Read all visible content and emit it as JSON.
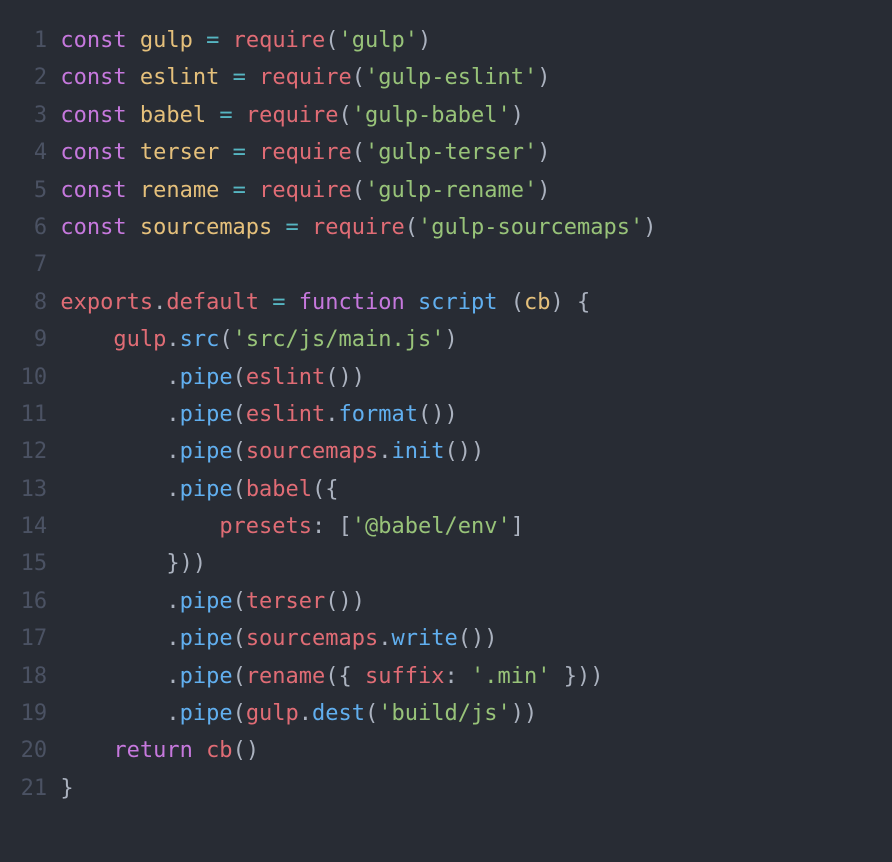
{
  "code": {
    "lines": [
      {
        "num": "1",
        "tokens": [
          {
            "t": "const ",
            "c": "kw"
          },
          {
            "t": "gulp",
            "c": "var"
          },
          {
            "t": " ",
            "c": "default"
          },
          {
            "t": "=",
            "c": "op"
          },
          {
            "t": " ",
            "c": "default"
          },
          {
            "t": "require",
            "c": "call"
          },
          {
            "t": "(",
            "c": "punc"
          },
          {
            "t": "'gulp'",
            "c": "str"
          },
          {
            "t": ")",
            "c": "punc"
          }
        ]
      },
      {
        "num": "2",
        "tokens": [
          {
            "t": "const ",
            "c": "kw"
          },
          {
            "t": "eslint",
            "c": "var"
          },
          {
            "t": " ",
            "c": "default"
          },
          {
            "t": "=",
            "c": "op"
          },
          {
            "t": " ",
            "c": "default"
          },
          {
            "t": "require",
            "c": "call"
          },
          {
            "t": "(",
            "c": "punc"
          },
          {
            "t": "'gulp-eslint'",
            "c": "str"
          },
          {
            "t": ")",
            "c": "punc"
          }
        ]
      },
      {
        "num": "3",
        "tokens": [
          {
            "t": "const ",
            "c": "kw"
          },
          {
            "t": "babel",
            "c": "var"
          },
          {
            "t": " ",
            "c": "default"
          },
          {
            "t": "=",
            "c": "op"
          },
          {
            "t": " ",
            "c": "default"
          },
          {
            "t": "require",
            "c": "call"
          },
          {
            "t": "(",
            "c": "punc"
          },
          {
            "t": "'gulp-babel'",
            "c": "str"
          },
          {
            "t": ")",
            "c": "punc"
          }
        ]
      },
      {
        "num": "4",
        "tokens": [
          {
            "t": "const ",
            "c": "kw"
          },
          {
            "t": "terser",
            "c": "var"
          },
          {
            "t": " ",
            "c": "default"
          },
          {
            "t": "=",
            "c": "op"
          },
          {
            "t": " ",
            "c": "default"
          },
          {
            "t": "require",
            "c": "call"
          },
          {
            "t": "(",
            "c": "punc"
          },
          {
            "t": "'gulp-terser'",
            "c": "str"
          },
          {
            "t": ")",
            "c": "punc"
          }
        ]
      },
      {
        "num": "5",
        "tokens": [
          {
            "t": "const ",
            "c": "kw"
          },
          {
            "t": "rename",
            "c": "var"
          },
          {
            "t": " ",
            "c": "default"
          },
          {
            "t": "=",
            "c": "op"
          },
          {
            "t": " ",
            "c": "default"
          },
          {
            "t": "require",
            "c": "call"
          },
          {
            "t": "(",
            "c": "punc"
          },
          {
            "t": "'gulp-rename'",
            "c": "str"
          },
          {
            "t": ")",
            "c": "punc"
          }
        ]
      },
      {
        "num": "6",
        "tokens": [
          {
            "t": "const ",
            "c": "kw"
          },
          {
            "t": "sourcemaps",
            "c": "var"
          },
          {
            "t": " ",
            "c": "default"
          },
          {
            "t": "=",
            "c": "op"
          },
          {
            "t": " ",
            "c": "default"
          },
          {
            "t": "require",
            "c": "call"
          },
          {
            "t": "(",
            "c": "punc"
          },
          {
            "t": "'gulp-sourcemaps'",
            "c": "str"
          },
          {
            "t": ")",
            "c": "punc"
          }
        ]
      },
      {
        "num": "7",
        "tokens": [
          {
            "t": "",
            "c": "default"
          }
        ]
      },
      {
        "num": "8",
        "tokens": [
          {
            "t": "exports",
            "c": "obj"
          },
          {
            "t": ".",
            "c": "dot"
          },
          {
            "t": "default",
            "c": "prop"
          },
          {
            "t": " ",
            "c": "default"
          },
          {
            "t": "=",
            "c": "op"
          },
          {
            "t": " ",
            "c": "default"
          },
          {
            "t": "function ",
            "c": "kw"
          },
          {
            "t": "script ",
            "c": "fnname"
          },
          {
            "t": "(",
            "c": "punc"
          },
          {
            "t": "cb",
            "c": "param"
          },
          {
            "t": ")",
            "c": "punc"
          },
          {
            "t": " ",
            "c": "default"
          },
          {
            "t": "{",
            "c": "punc"
          }
        ]
      },
      {
        "num": "9",
        "tokens": [
          {
            "t": "    ",
            "c": "default"
          },
          {
            "t": "gulp",
            "c": "obj"
          },
          {
            "t": ".",
            "c": "dot"
          },
          {
            "t": "src",
            "c": "method"
          },
          {
            "t": "(",
            "c": "punc"
          },
          {
            "t": "'src/js/main.js'",
            "c": "str"
          },
          {
            "t": ")",
            "c": "punc"
          }
        ]
      },
      {
        "num": "10",
        "tokens": [
          {
            "t": "        ",
            "c": "default"
          },
          {
            "t": ".",
            "c": "dot"
          },
          {
            "t": "pipe",
            "c": "method"
          },
          {
            "t": "(",
            "c": "punc"
          },
          {
            "t": "eslint",
            "c": "call"
          },
          {
            "t": "(",
            "c": "punc"
          },
          {
            "t": ")",
            "c": "punc"
          },
          {
            "t": ")",
            "c": "punc"
          }
        ]
      },
      {
        "num": "11",
        "tokens": [
          {
            "t": "        ",
            "c": "default"
          },
          {
            "t": ".",
            "c": "dot"
          },
          {
            "t": "pipe",
            "c": "method"
          },
          {
            "t": "(",
            "c": "punc"
          },
          {
            "t": "eslint",
            "c": "obj"
          },
          {
            "t": ".",
            "c": "dot"
          },
          {
            "t": "format",
            "c": "method"
          },
          {
            "t": "(",
            "c": "punc"
          },
          {
            "t": ")",
            "c": "punc"
          },
          {
            "t": ")",
            "c": "punc"
          }
        ]
      },
      {
        "num": "12",
        "tokens": [
          {
            "t": "        ",
            "c": "default"
          },
          {
            "t": ".",
            "c": "dot"
          },
          {
            "t": "pipe",
            "c": "method"
          },
          {
            "t": "(",
            "c": "punc"
          },
          {
            "t": "sourcemaps",
            "c": "obj"
          },
          {
            "t": ".",
            "c": "dot"
          },
          {
            "t": "init",
            "c": "method"
          },
          {
            "t": "(",
            "c": "punc"
          },
          {
            "t": ")",
            "c": "punc"
          },
          {
            "t": ")",
            "c": "punc"
          }
        ]
      },
      {
        "num": "13",
        "tokens": [
          {
            "t": "        ",
            "c": "default"
          },
          {
            "t": ".",
            "c": "dot"
          },
          {
            "t": "pipe",
            "c": "method"
          },
          {
            "t": "(",
            "c": "punc"
          },
          {
            "t": "babel",
            "c": "call"
          },
          {
            "t": "(",
            "c": "punc"
          },
          {
            "t": "{",
            "c": "punc"
          }
        ]
      },
      {
        "num": "14",
        "tokens": [
          {
            "t": "            ",
            "c": "default"
          },
          {
            "t": "presets",
            "c": "pname"
          },
          {
            "t": ":",
            "c": "punc"
          },
          {
            "t": " ",
            "c": "default"
          },
          {
            "t": "[",
            "c": "punc"
          },
          {
            "t": "'@babel/env'",
            "c": "str"
          },
          {
            "t": "]",
            "c": "punc"
          }
        ]
      },
      {
        "num": "15",
        "tokens": [
          {
            "t": "        ",
            "c": "default"
          },
          {
            "t": "}",
            "c": "punc"
          },
          {
            "t": ")",
            "c": "punc"
          },
          {
            "t": ")",
            "c": "punc"
          }
        ]
      },
      {
        "num": "16",
        "tokens": [
          {
            "t": "        ",
            "c": "default"
          },
          {
            "t": ".",
            "c": "dot"
          },
          {
            "t": "pipe",
            "c": "method"
          },
          {
            "t": "(",
            "c": "punc"
          },
          {
            "t": "terser",
            "c": "call"
          },
          {
            "t": "(",
            "c": "punc"
          },
          {
            "t": ")",
            "c": "punc"
          },
          {
            "t": ")",
            "c": "punc"
          }
        ]
      },
      {
        "num": "17",
        "tokens": [
          {
            "t": "        ",
            "c": "default"
          },
          {
            "t": ".",
            "c": "dot"
          },
          {
            "t": "pipe",
            "c": "method"
          },
          {
            "t": "(",
            "c": "punc"
          },
          {
            "t": "sourcemaps",
            "c": "obj"
          },
          {
            "t": ".",
            "c": "dot"
          },
          {
            "t": "write",
            "c": "method"
          },
          {
            "t": "(",
            "c": "punc"
          },
          {
            "t": ")",
            "c": "punc"
          },
          {
            "t": ")",
            "c": "punc"
          }
        ]
      },
      {
        "num": "18",
        "tokens": [
          {
            "t": "        ",
            "c": "default"
          },
          {
            "t": ".",
            "c": "dot"
          },
          {
            "t": "pipe",
            "c": "method"
          },
          {
            "t": "(",
            "c": "punc"
          },
          {
            "t": "rename",
            "c": "call"
          },
          {
            "t": "(",
            "c": "punc"
          },
          {
            "t": "{",
            "c": "punc"
          },
          {
            "t": " ",
            "c": "default"
          },
          {
            "t": "suffix",
            "c": "pname"
          },
          {
            "t": ":",
            "c": "punc"
          },
          {
            "t": " ",
            "c": "default"
          },
          {
            "t": "'.min'",
            "c": "str"
          },
          {
            "t": " ",
            "c": "default"
          },
          {
            "t": "}",
            "c": "punc"
          },
          {
            "t": ")",
            "c": "punc"
          },
          {
            "t": ")",
            "c": "punc"
          }
        ]
      },
      {
        "num": "19",
        "tokens": [
          {
            "t": "        ",
            "c": "default"
          },
          {
            "t": ".",
            "c": "dot"
          },
          {
            "t": "pipe",
            "c": "method"
          },
          {
            "t": "(",
            "c": "punc"
          },
          {
            "t": "gulp",
            "c": "obj"
          },
          {
            "t": ".",
            "c": "dot"
          },
          {
            "t": "dest",
            "c": "method"
          },
          {
            "t": "(",
            "c": "punc"
          },
          {
            "t": "'build/js'",
            "c": "str"
          },
          {
            "t": ")",
            "c": "punc"
          },
          {
            "t": ")",
            "c": "punc"
          }
        ]
      },
      {
        "num": "20",
        "tokens": [
          {
            "t": "    ",
            "c": "default"
          },
          {
            "t": "return ",
            "c": "kw"
          },
          {
            "t": "cb",
            "c": "call"
          },
          {
            "t": "(",
            "c": "punc"
          },
          {
            "t": ")",
            "c": "punc"
          }
        ]
      },
      {
        "num": "21",
        "tokens": [
          {
            "t": "}",
            "c": "punc"
          }
        ]
      }
    ]
  }
}
